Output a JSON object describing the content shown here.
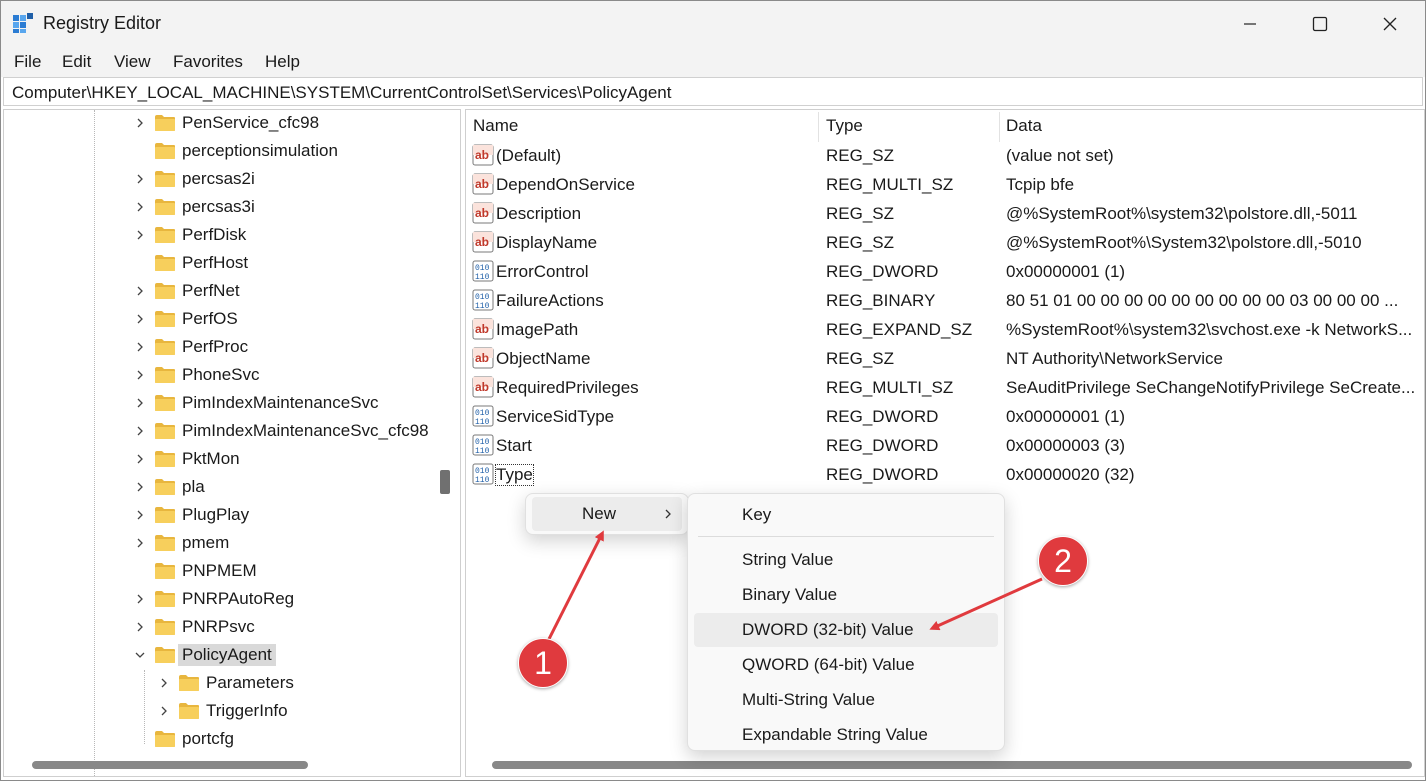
{
  "window": {
    "title": "Registry Editor",
    "controls": {
      "minimize_icon": "minimize-icon",
      "maximize_icon": "maximize-icon",
      "close_icon": "close-icon"
    }
  },
  "menu": [
    "File",
    "Edit",
    "View",
    "Favorites",
    "Help"
  ],
  "address": "Computer\\HKEY_LOCAL_MACHINE\\SYSTEM\\CurrentControlSet\\Services\\PolicyAgent",
  "tree": [
    {
      "label": "PenService_cfc98",
      "expandable": true
    },
    {
      "label": "perceptionsimulation",
      "expandable": false
    },
    {
      "label": "percsas2i",
      "expandable": true
    },
    {
      "label": "percsas3i",
      "expandable": true
    },
    {
      "label": "PerfDisk",
      "expandable": true
    },
    {
      "label": "PerfHost",
      "expandable": false
    },
    {
      "label": "PerfNet",
      "expandable": true
    },
    {
      "label": "PerfOS",
      "expandable": true
    },
    {
      "label": "PerfProc",
      "expandable": true
    },
    {
      "label": "PhoneSvc",
      "expandable": true
    },
    {
      "label": "PimIndexMaintenanceSvc",
      "expandable": true
    },
    {
      "label": "PimIndexMaintenanceSvc_cfc98",
      "expandable": true
    },
    {
      "label": "PktMon",
      "expandable": true
    },
    {
      "label": "pla",
      "expandable": true
    },
    {
      "label": "PlugPlay",
      "expandable": true
    },
    {
      "label": "pmem",
      "expandable": true
    },
    {
      "label": "PNPMEM",
      "expandable": false
    },
    {
      "label": "PNRPAutoReg",
      "expandable": true
    },
    {
      "label": "PNRPsvc",
      "expandable": true
    },
    {
      "label": "PolicyAgent",
      "expandable": true,
      "expanded": true,
      "selected": true
    },
    {
      "label": "Parameters",
      "expandable": true,
      "child": true
    },
    {
      "label": "TriggerInfo",
      "expandable": true,
      "child": true
    },
    {
      "label": "portcfg",
      "expandable": false
    }
  ],
  "columns": {
    "name": "Name",
    "type": "Type",
    "data": "Data"
  },
  "values": [
    {
      "name": "(Default)",
      "type": "REG_SZ",
      "data": "(value not set)",
      "icon": "string-value-icon"
    },
    {
      "name": "DependOnService",
      "type": "REG_MULTI_SZ",
      "data": "Tcpip bfe",
      "icon": "string-value-icon"
    },
    {
      "name": "Description",
      "type": "REG_SZ",
      "data": "@%SystemRoot%\\system32\\polstore.dll,-5011",
      "icon": "string-value-icon"
    },
    {
      "name": "DisplayName",
      "type": "REG_SZ",
      "data": "@%SystemRoot%\\System32\\polstore.dll,-5010",
      "icon": "string-value-icon"
    },
    {
      "name": "ErrorControl",
      "type": "REG_DWORD",
      "data": "0x00000001 (1)",
      "icon": "binary-value-icon"
    },
    {
      "name": "FailureActions",
      "type": "REG_BINARY",
      "data": "80 51 01 00 00 00 00 00 00 00 00 00 03 00 00 00 ...",
      "icon": "binary-value-icon"
    },
    {
      "name": "ImagePath",
      "type": "REG_EXPAND_SZ",
      "data": "%SystemRoot%\\system32\\svchost.exe -k NetworkS...",
      "icon": "string-value-icon"
    },
    {
      "name": "ObjectName",
      "type": "REG_SZ",
      "data": "NT Authority\\NetworkService",
      "icon": "string-value-icon"
    },
    {
      "name": "RequiredPrivileges",
      "type": "REG_MULTI_SZ",
      "data": "SeAuditPrivilege SeChangeNotifyPrivilege SeCreate...",
      "icon": "string-value-icon"
    },
    {
      "name": "ServiceSidType",
      "type": "REG_DWORD",
      "data": "0x00000001 (1)",
      "icon": "binary-value-icon"
    },
    {
      "name": "Start",
      "type": "REG_DWORD",
      "data": "0x00000003 (3)",
      "icon": "binary-value-icon"
    },
    {
      "name": "Type",
      "type": "REG_DWORD",
      "data": "0x00000020 (32)",
      "icon": "binary-value-icon"
    }
  ],
  "context_menu": {
    "new_label": "New",
    "submenu": [
      "Key",
      "String Value",
      "Binary Value",
      "DWORD (32-bit) Value",
      "QWORD (64-bit) Value",
      "Multi-String Value",
      "Expandable String Value"
    ]
  },
  "annotations": {
    "step1": "1",
    "step2": "2",
    "badge_color": "#e03a3e"
  }
}
